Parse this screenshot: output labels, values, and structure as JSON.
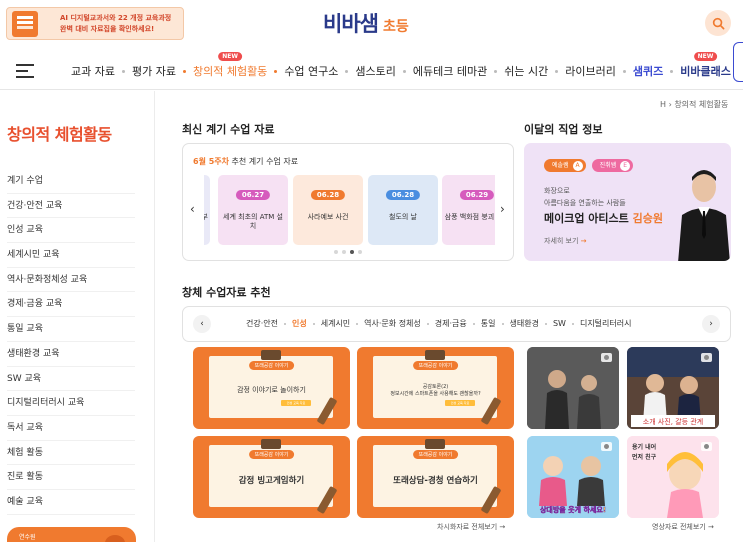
{
  "header": {
    "promo_line1": "AI 디지털교과서와 22 개정 교육과정",
    "promo_line2": "완벽 대비 자료집을 확인하세요!",
    "logo_main": "비바샘",
    "logo_sub": "초등",
    "nav": [
      {
        "label": "교과 자료",
        "badge": ""
      },
      {
        "label": "평가 자료",
        "badge": ""
      },
      {
        "label": "창의적 체험활동",
        "badge": "NEW",
        "active": true
      },
      {
        "label": "수업 연구소",
        "badge": ""
      },
      {
        "label": "샘스토리",
        "badge": ""
      },
      {
        "label": "에듀테크 테마관",
        "badge": ""
      },
      {
        "label": "쉬는 시간",
        "badge": ""
      },
      {
        "label": "라이브러리",
        "badge": ""
      },
      {
        "label": "샘퀴즈",
        "badge": ""
      },
      {
        "label": "비바클래스",
        "badge": "NEW"
      }
    ]
  },
  "breadcrumb": "창의적 체험활동",
  "sidebar": {
    "title": "창의적 체험활동",
    "items": [
      "계기 수업",
      "건강·안전 교육",
      "인성 교육",
      "세계시민 교육",
      "역사·문화정체성 교육",
      "경제·금융 교육",
      "통일 교육",
      "생태환경 교육",
      "SW 교육",
      "디지털리터러시 교육",
      "독서 교육",
      "체험 활동",
      "진로 활동",
      "예술 교육"
    ],
    "banner_text": "연수원"
  },
  "weekly": {
    "section_title": "최신 계기 수업 자료",
    "label_highlight": "6월 5주차",
    "label_rest": " 추천 계기 수업 자료",
    "prev_label": "‹",
    "next_label": "›",
    "cards": [
      {
        "date": "",
        "title": "부",
        "bg": "#e9e9f7",
        "pill": "#7b6be0"
      },
      {
        "date": "06.27",
        "title": "세계 최초의 ATM 설치",
        "bg": "#f6e1f3",
        "pill": "#d65bbd"
      },
      {
        "date": "06.28",
        "title": "사라예보 사건",
        "bg": "#fde9dc",
        "pill": "#f07a2f"
      },
      {
        "date": "06.28",
        "title": "철도의 날",
        "bg": "#dde8f6",
        "pill": "#4a8ee0"
      },
      {
        "date": "06.29",
        "title": "삼풍 백화점 붕괴 사고",
        "bg": "#f6e1f3",
        "pill": "#d65bbd"
      }
    ]
  },
  "job": {
    "section_title": "이달의 직업 정보",
    "pill1": "예솔쌤",
    "pill1_mark": "A",
    "pill2": "진취쌤",
    "pill2_mark": "E",
    "line1": "화장으로",
    "line2": "아름다움을 연출하는 사람들",
    "title_main": "메이크업 아티스트 ",
    "title_name": "김승원",
    "more": "자세히 보기",
    "more_arrow": "→"
  },
  "creative": {
    "section_title": "창체 수업자료 추천",
    "categories": [
      "건강·안전",
      "인성",
      "세계시민",
      "역사·문화 정체성",
      "경제·금융",
      "통일",
      "생태환경",
      "SW",
      "디지털리터러시"
    ],
    "prev_label": "‹",
    "next_label": "›",
    "tiles": [
      {
        "pill": "또래공감 이야기",
        "title": "감정 이야기로 놀이하기",
        "foot": "인성 교육 자료"
      },
      {
        "pill": "또래공감 이야기",
        "title": "공감토론(2)\n정보시간에 스마트폰을 사용해도 괜찮을까?",
        "foot": "인성 교육 자료"
      },
      {
        "pill": "또래공감 이야기",
        "title": "감정 빙고게임하기",
        "foot": "인성 교육 자료"
      },
      {
        "pill": "또래공감 이야기",
        "title": "또래상담-경청 연습하기",
        "foot": "인성 교육 자료"
      }
    ],
    "photo_caption_1": "소개 사진, 갈등 관계",
    "photo_caption_2": "상대방을 웃게 하세요!",
    "photo_caption_3": "용기 내어\n먼저 친구",
    "more_left": "차시화자료 전체보기",
    "more_right": "영상자료 전체보기",
    "more_arrow": "→"
  }
}
